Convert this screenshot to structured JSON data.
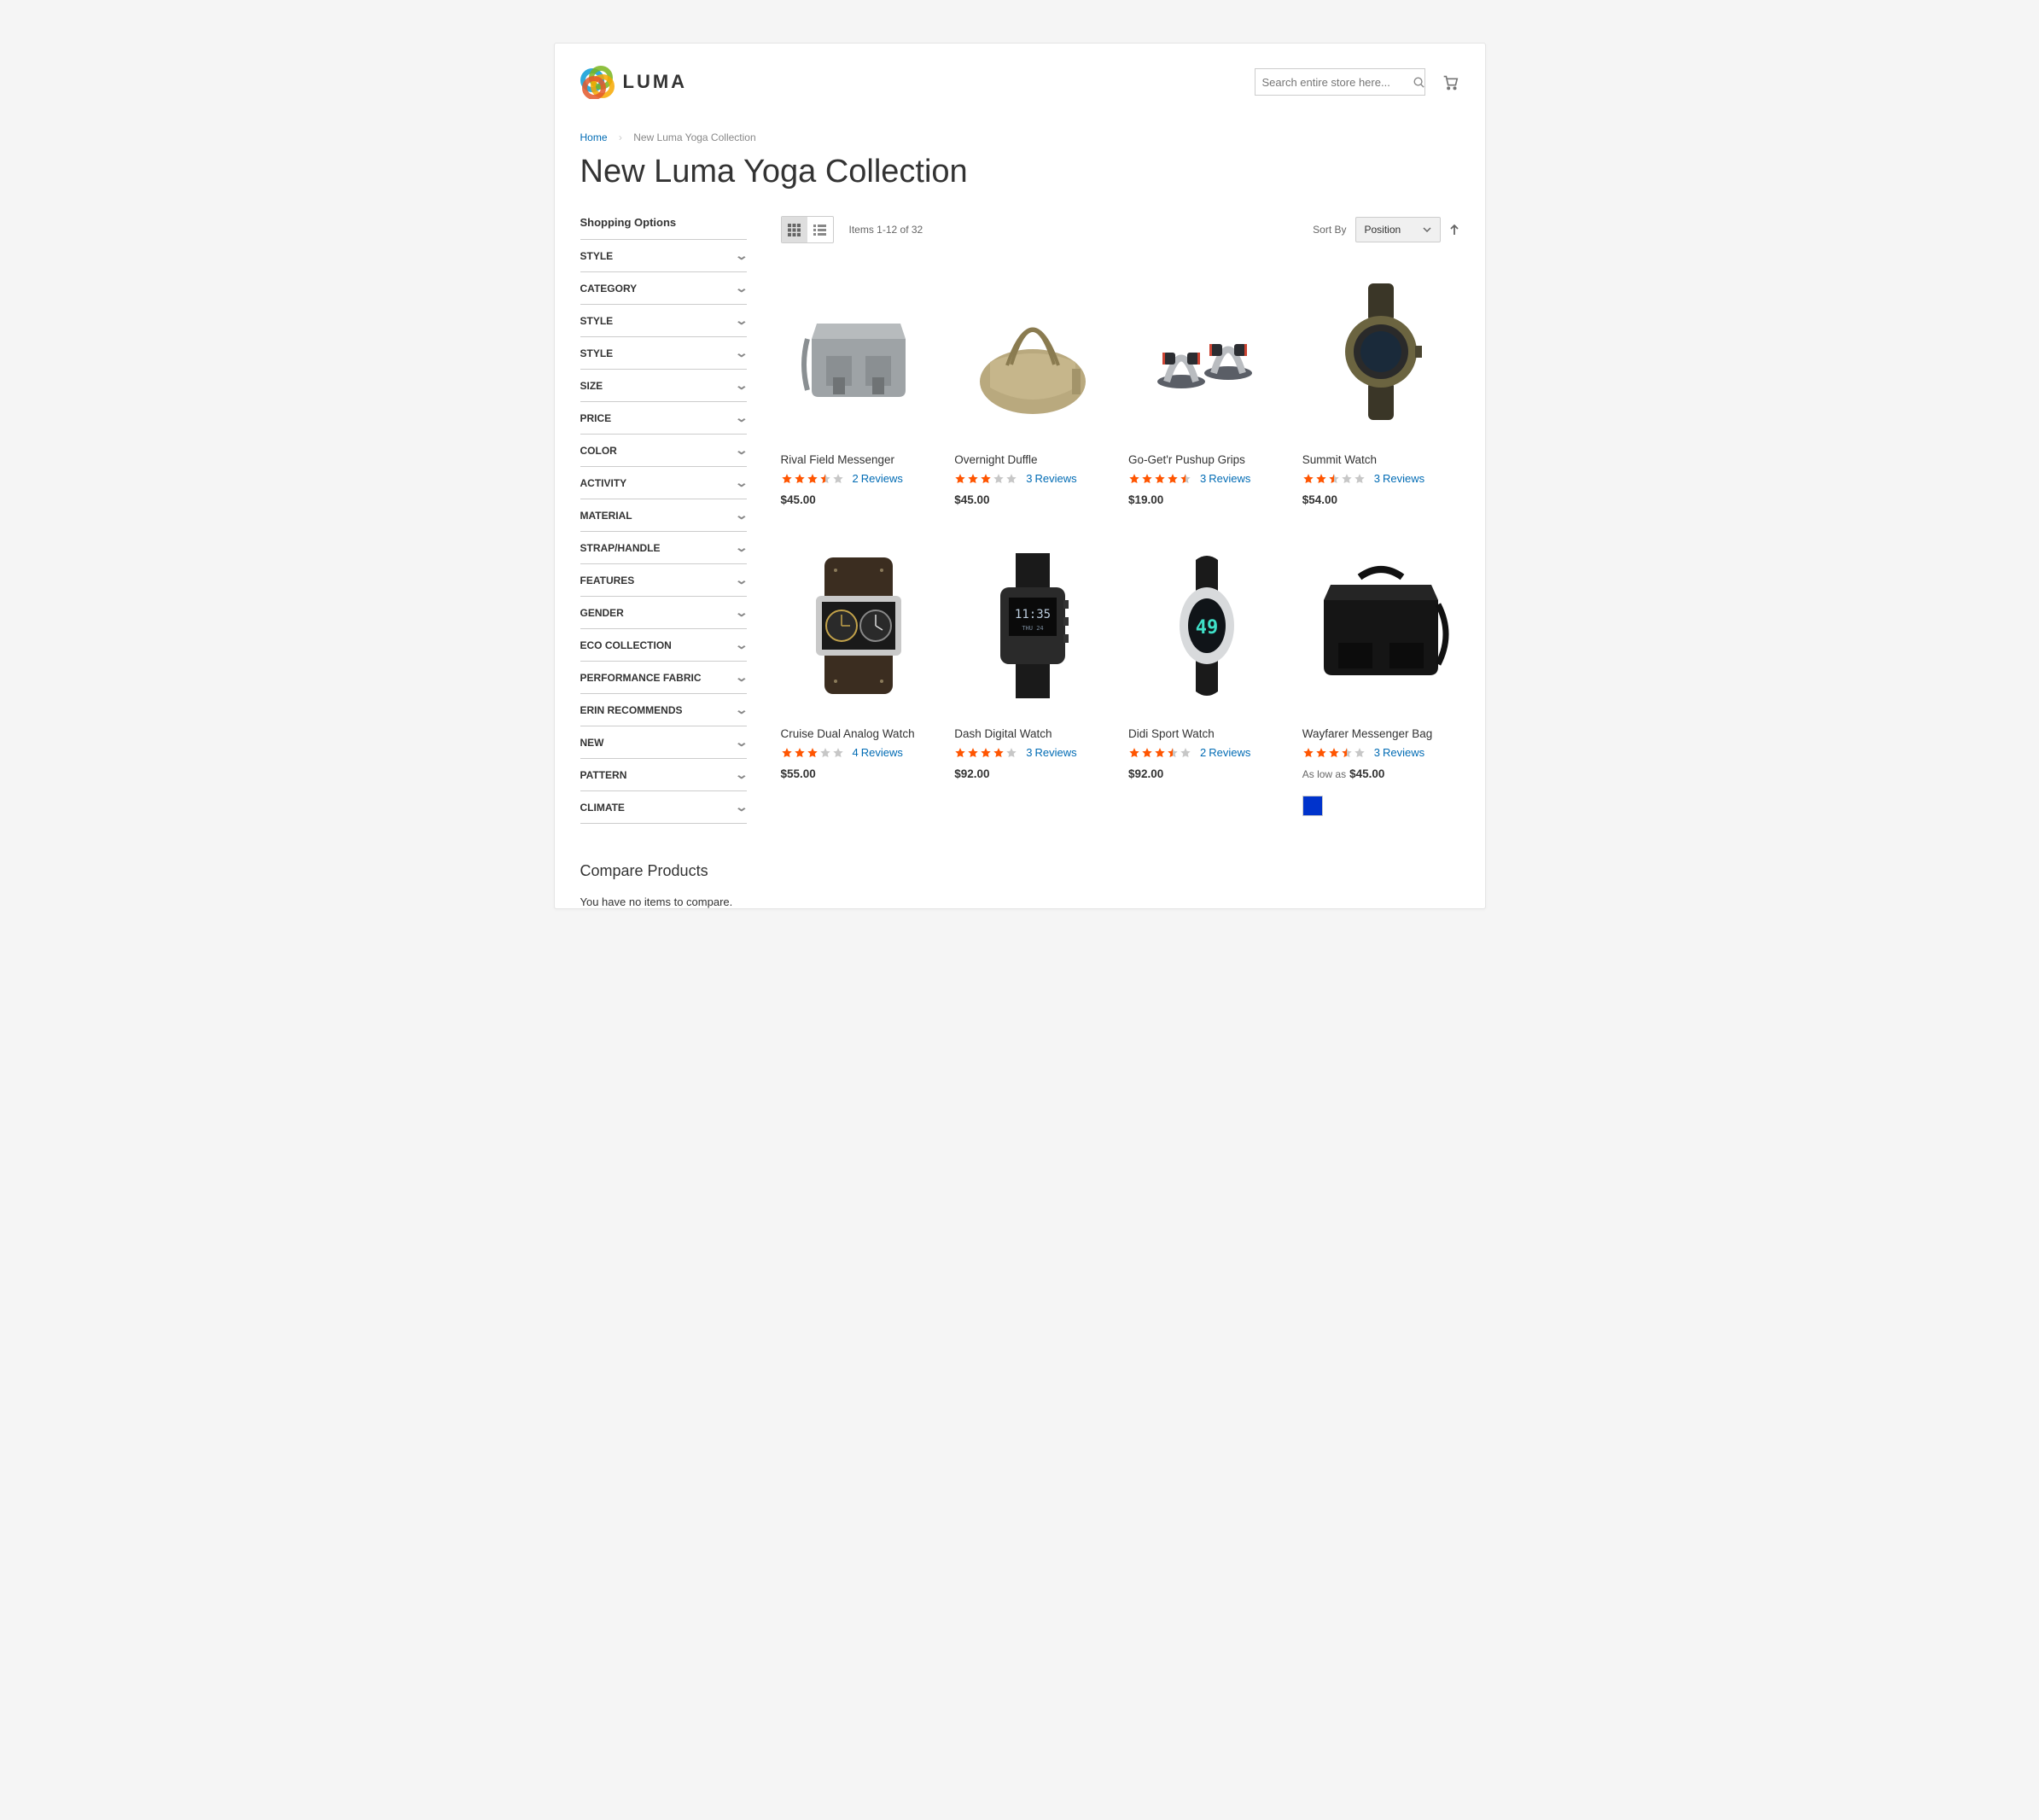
{
  "brand": "LUMA",
  "search": {
    "placeholder": "Search entire store here..."
  },
  "breadcrumb": {
    "home": "Home",
    "current": "New Luma Yoga Collection"
  },
  "page_title": "New Luma Yoga Collection",
  "sidebar": {
    "heading": "Shopping Options",
    "filters": [
      "STYLE",
      "CATEGORY",
      "STYLE",
      "STYLE",
      "SIZE",
      "PRICE",
      "COLOR",
      "ACTIVITY",
      "MATERIAL",
      "STRAP/HANDLE",
      "FEATURES",
      "GENDER",
      "ECO COLLECTION",
      "PERFORMANCE FABRIC",
      "ERIN RECOMMENDS",
      "NEW",
      "PATTERN",
      "CLIMATE"
    ],
    "compare_heading": "Compare Products",
    "compare_empty": "You have no items to compare."
  },
  "toolbar": {
    "amount": "Items 1-12 of 32",
    "sort_label": "Sort By",
    "sort_value": "Position"
  },
  "products": [
    {
      "name": "Rival Field Messenger",
      "rating": 3.5,
      "reviews": 2,
      "price": "$45.00"
    },
    {
      "name": "Overnight Duffle",
      "rating": 3.0,
      "reviews": 3,
      "price": "$45.00"
    },
    {
      "name": "Go-Get'r Pushup Grips",
      "rating": 4.5,
      "reviews": 3,
      "price": "$19.00"
    },
    {
      "name": "Summit Watch",
      "rating": 2.5,
      "reviews": 3,
      "price": "$54.00"
    },
    {
      "name": "Cruise Dual Analog Watch",
      "rating": 3.0,
      "reviews": 4,
      "price": "$55.00"
    },
    {
      "name": "Dash Digital Watch",
      "rating": 4.0,
      "reviews": 3,
      "price": "$92.00"
    },
    {
      "name": "Didi Sport Watch",
      "rating": 3.5,
      "reviews": 2,
      "price": "$92.00"
    },
    {
      "name": "Wayfarer Messenger Bag",
      "rating": 3.5,
      "reviews": 3,
      "price_label": "As low as",
      "price": "$45.00",
      "swatches": [
        "#0033cc"
      ]
    }
  ],
  "reviews_word": "Reviews"
}
